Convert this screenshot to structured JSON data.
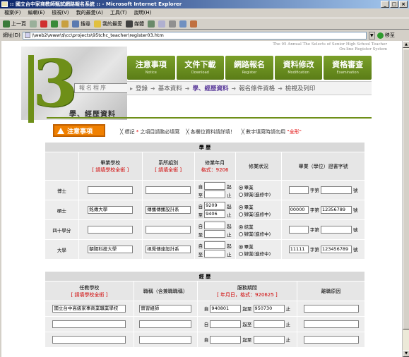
{
  "window": {
    "title": ":: 國立台中家商教師甄試網路報名系統 :: - Microsoft Internet Explorer",
    "btns": [
      "_",
      "□",
      "×"
    ]
  },
  "menu": [
    "檔案(F)",
    "編輯(E)",
    "檢視(V)",
    "我的最愛(A)",
    "工具(T)",
    "說明(H)"
  ],
  "toolbar": {
    "back": "上一頁",
    "search": "搜尋",
    "favorites": "我的最愛",
    "media": "媒體"
  },
  "address": {
    "label": "網址(D)",
    "url": "\\\\web2\\www\\$\\cc\\projects\\95tchc_teacher\\register03.htm",
    "go": "移至"
  },
  "banner": {
    "en1": "The 95 Annual The Selects of Senior High School Teacher",
    "en2": "On-line Register System",
    "reg": "報名程序"
  },
  "nav": [
    {
      "zh": "注意事項",
      "en": "Notice"
    },
    {
      "zh": "文件下載",
      "en": "Download"
    },
    {
      "zh": "網路報名",
      "en": "Register"
    },
    {
      "zh": "資料修改",
      "en": "Modification"
    },
    {
      "zh": "資格審查",
      "en": "Examination"
    }
  ],
  "crumbs": {
    "s1": "登錄",
    "s2": "基本資料",
    "s3": "學、經歷資料",
    "s4": "報名條件資格",
    "s5": "檢視及列印"
  },
  "section_title": "學、經歷資料",
  "notice_btn": "注意事項",
  "notes": {
    "n1a": "╳ 標記",
    "star": "*",
    "n1b": "之項目請務必填寫",
    "n2": "╳ 各欄位資料請詳填！",
    "n3": "╳ 數字填寫時請勿用",
    "fw": "\"全形\""
  },
  "edu": {
    "title": "學 歷",
    "h_school": "畢業學校",
    "h_school_note": "[ 請填學校全銜 ]",
    "h_dept": "系所組別",
    "h_dept_note": "[ 請填全銜 ]",
    "h_ym": "修業年月",
    "h_ym_note": "格式：9206",
    "h_status": "修業狀況",
    "h_cert": "畢業（學位）證書字號",
    "from": "自",
    "to": "至",
    "mid": "起",
    "end": "止",
    "zi": "字第",
    "hao": "號",
    "opt1": "畢業",
    "opt2": "肄業(進修中)",
    "opt1b": "結業",
    "rows": [
      {
        "label": "博士",
        "school": "",
        "dept": "",
        "from": "",
        "to": "",
        "cert_a": "",
        "cert_b": ""
      },
      {
        "label": "碩士",
        "school": "銘傳大學",
        "dept": "傳播傳播設計系",
        "from": "9209",
        "to": "9406",
        "cert_a": "00000",
        "cert_b": "12356789"
      },
      {
        "label": "四十學分",
        "school": "",
        "dept": "",
        "from": "",
        "to": "",
        "cert_a": "",
        "cert_b": ""
      },
      {
        "label": "大學",
        "school": "朝陽科技大學",
        "dept": "視覺傳達設計系",
        "from": "",
        "to": "",
        "cert_a": "11111",
        "cert_b": "123456789"
      }
    ]
  },
  "exp": {
    "title": "經 歷",
    "h_school": "任教學校",
    "h_school_note": "[ 請填學校全銜 ]",
    "h_title": "職稱（含兼職職稱）",
    "h_period": "服務期間",
    "h_period_note": "[ 年月日，格式：920625 ]",
    "h_reason": "離職原因",
    "rows": [
      {
        "school": "國立台中高級家事商業職業學校",
        "title": "實習組師",
        "from": "940801",
        "to": "950730"
      },
      {
        "school": "",
        "title": "",
        "from": "",
        "to": ""
      },
      {
        "school": "",
        "title": "",
        "from": "",
        "to": ""
      }
    ]
  }
}
